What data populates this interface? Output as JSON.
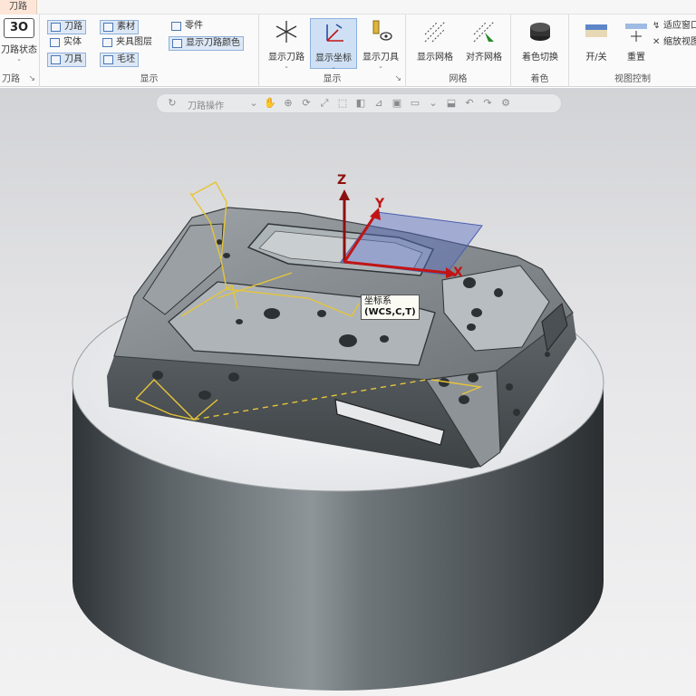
{
  "window": {
    "active_tab": "刀路"
  },
  "ribbon": {
    "group1": {
      "big_label": "刀路状态",
      "label": "刀路",
      "top_icon_text": "3O"
    },
    "group2": {
      "label": "显示",
      "items": [
        {
          "label": "刀路"
        },
        {
          "label": "素材"
        },
        {
          "label": "实体"
        },
        {
          "label": "刀具"
        },
        {
          "label": "夹具图层"
        },
        {
          "label": "毛坯"
        },
        {
          "label": "零件"
        },
        {
          "label": "显示刀路颜色"
        }
      ]
    },
    "group3": {
      "label": "显示",
      "buttons": [
        {
          "label": "显示刀路"
        },
        {
          "label": "显示坐标"
        },
        {
          "label": "显示刀具"
        }
      ]
    },
    "group4": {
      "label": "网格",
      "buttons": [
        {
          "label": "显示网格"
        },
        {
          "label": "对齐网格"
        }
      ]
    },
    "group5": {
      "label": "着色",
      "buttons": [
        {
          "label": "着色切换"
        }
      ]
    },
    "group6": {
      "label": "视图控制",
      "buttons": [
        {
          "label": "开/关"
        },
        {
          "label": "重置"
        }
      ],
      "small_items": [
        {
          "label": "适应窗口"
        },
        {
          "label": "缩放视图"
        }
      ]
    }
  },
  "quickbar": {
    "text": "刀路操作"
  },
  "viewport": {
    "wcs": {
      "title": "坐标系",
      "value": "(WCS,C,T)"
    },
    "axes": {
      "x": "X",
      "y": "Y",
      "z": "Z"
    },
    "colors": {
      "x_axis": "#c21414",
      "y_axis": "#c21414",
      "z_axis": "#8c1010",
      "plane": "#5a6fc4",
      "toolpath": "#e6c53a",
      "part": "#6f777d",
      "fixture": "#4a5055"
    }
  }
}
